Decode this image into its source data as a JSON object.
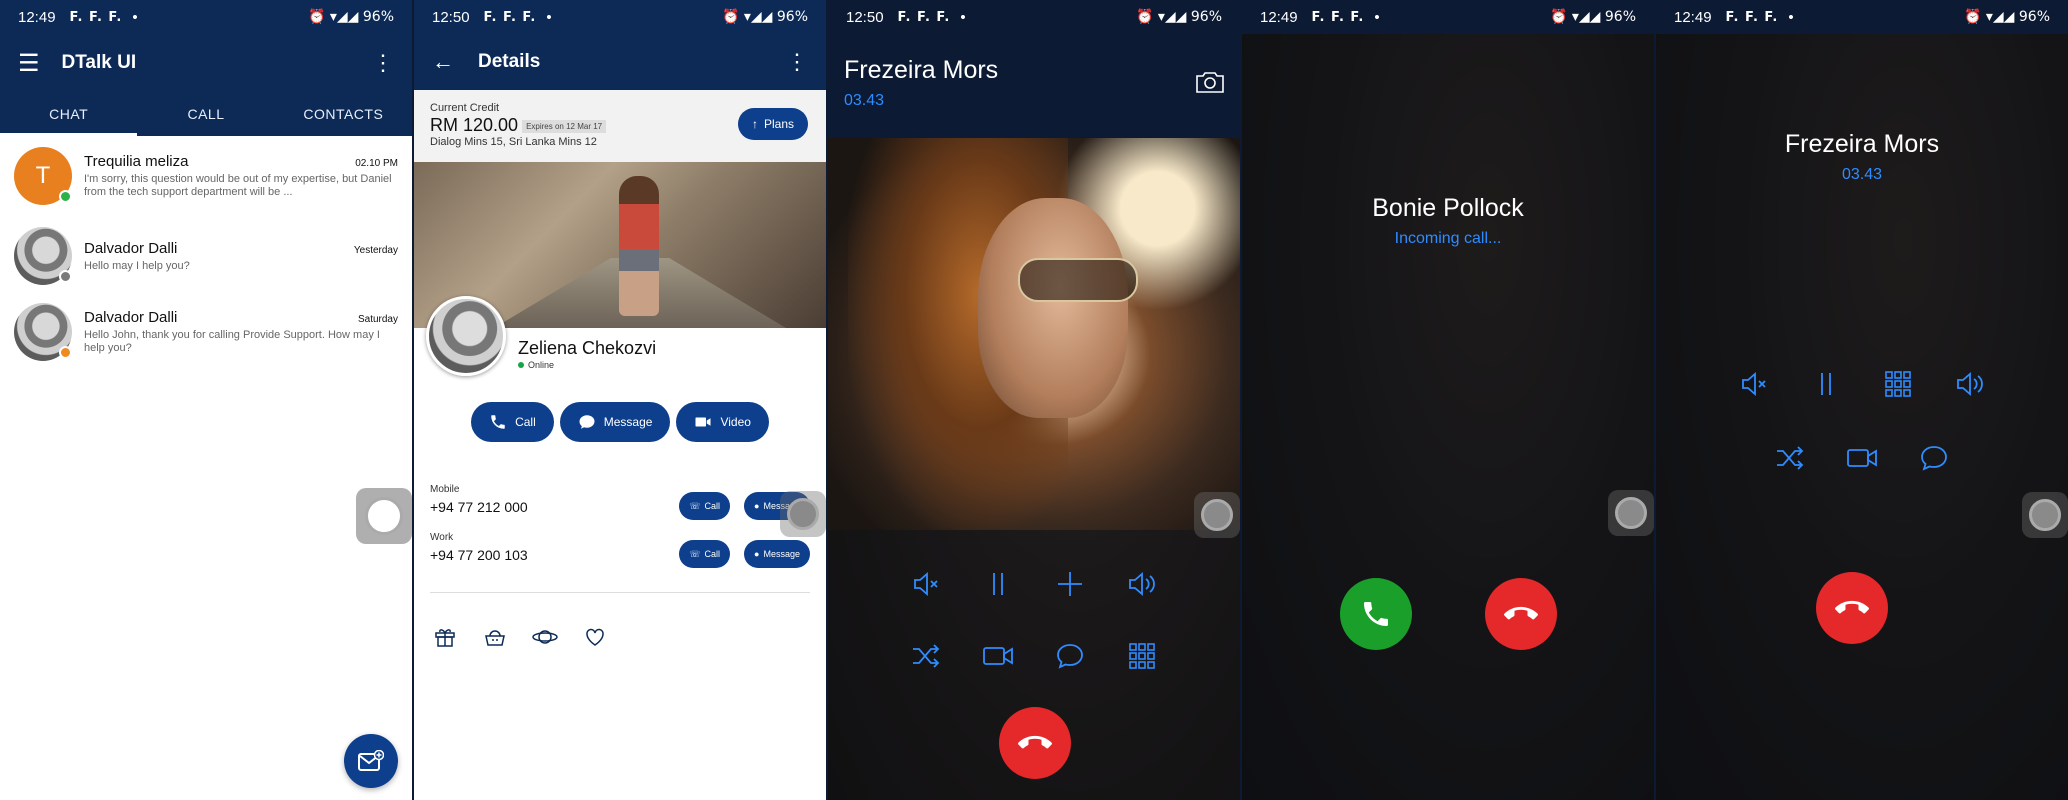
{
  "status_bars": [
    {
      "time": "12:49",
      "notes": "F. F. F.",
      "dot": "•",
      "battery": "96%"
    },
    {
      "time": "12:50",
      "notes": "F. F. F.",
      "dot": "•",
      "battery": "96%"
    },
    {
      "time": "12:50",
      "notes": "F. F. F.",
      "dot": "•",
      "battery": "96%"
    },
    {
      "time": "12:49",
      "notes": "F. F. F.",
      "dot": "•",
      "battery": "96%"
    },
    {
      "time": "12:49",
      "notes": "F. F. F.",
      "dot": "•",
      "battery": "96%"
    }
  ],
  "chat_screen": {
    "app_title": "DTalk UI",
    "tabs": [
      "CHAT",
      "CALL",
      "CONTACTS"
    ],
    "active_tab": "CHAT",
    "chats": [
      {
        "initial": "T",
        "name": "Trequilia meliza",
        "time": "02.10 PM",
        "message": "I'm sorry, this question would be out of my expertise, but Daniel from the tech support department will be ...",
        "status_color": "#2bb34a"
      },
      {
        "initial": "",
        "name": "Dalvador Dalli",
        "time": "Yesterday",
        "message": "Hello may I help you?",
        "status_color": "#7a7a7a"
      },
      {
        "initial": "",
        "name": "Dalvador Dalli",
        "time": "Saturday",
        "message": "Hello John, thank you for calling Provide Support. How may I help you?",
        "status_color": "#f08a1e"
      }
    ],
    "fab_icon": "new-message-icon"
  },
  "details_screen": {
    "title": "Details",
    "credit_label": "Current Credit",
    "credit_amount": "RM 120.00",
    "credit_expiry": "Expires on 12 Mar 17",
    "credit_mins": "Dialog Mins 15, Sri Lanka Mins 12",
    "plans_label": "Plans",
    "profile_name": "Zeliena Chekozvi",
    "profile_status": "Online",
    "actions": [
      "Call",
      "Message",
      "Video"
    ],
    "contacts": [
      {
        "label": "Mobile",
        "number": "+94 77 212 000",
        "call": "Call",
        "message": "Message"
      },
      {
        "label": "Work",
        "number": "+94 77 200 103",
        "call": "Call",
        "message": "Message"
      }
    ],
    "icons": [
      "gift-icon",
      "basket-icon",
      "planet-icon",
      "heart-icon"
    ]
  },
  "video_call": {
    "name": "Frezeira Mors",
    "duration": "03.43"
  },
  "incoming_call": {
    "name": "Bonie Pollock",
    "status": "Incoming call..."
  },
  "voice_call": {
    "name": "Frezeira Mors",
    "duration": "03.43"
  },
  "colors": {
    "primary": "#0d2a57",
    "accent_blue": "#2f8cff",
    "end_red": "#e5282a",
    "accept_green": "#1aa02a"
  }
}
